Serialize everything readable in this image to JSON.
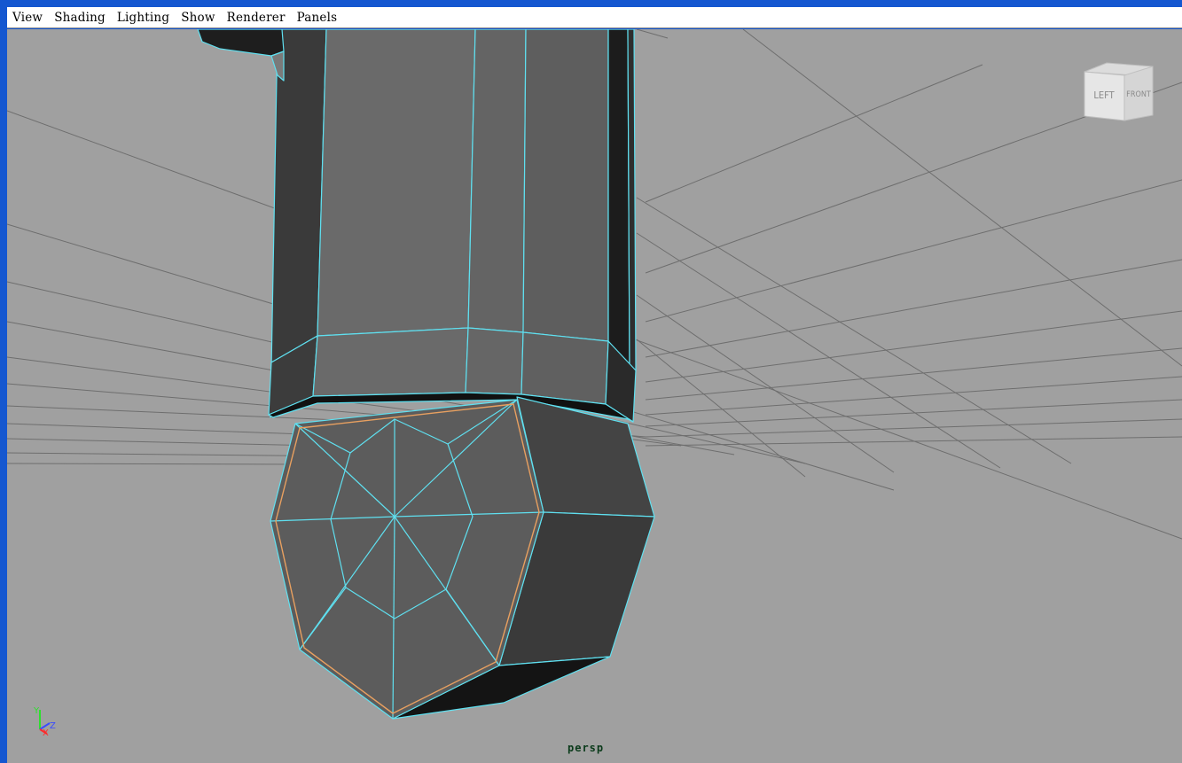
{
  "menubar": {
    "items": [
      {
        "label": "View"
      },
      {
        "label": "Shading"
      },
      {
        "label": "Lighting"
      },
      {
        "label": "Show"
      },
      {
        "label": "Renderer"
      },
      {
        "label": "Panels"
      }
    ]
  },
  "viewcube": {
    "left_face": "LEFT",
    "front_face": "FRONT"
  },
  "axis_indicator": {
    "y": "Y",
    "x": "X",
    "z": "Z"
  },
  "viewport": {
    "camera_label": "persp"
  },
  "colors": {
    "frame": "#1457d0",
    "viewport_bg": "#a0a0a0",
    "wireframe": "#5fe0f0",
    "selection_edge": "#e8a060"
  }
}
